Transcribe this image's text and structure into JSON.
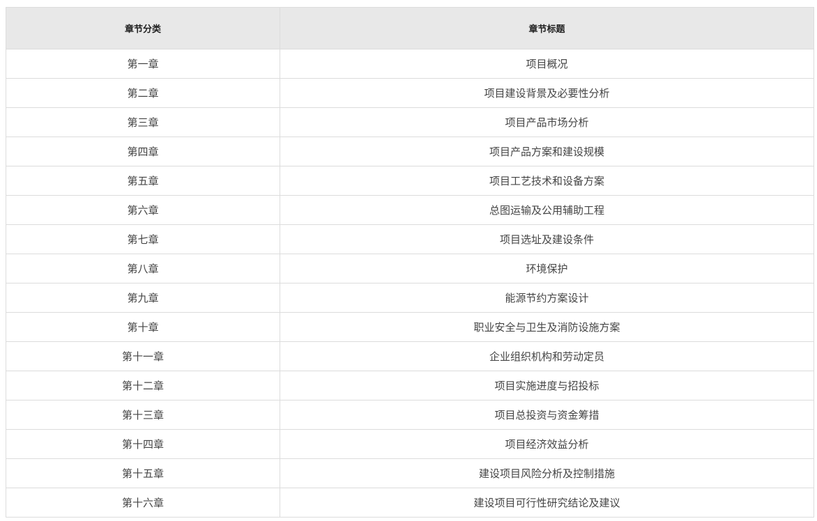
{
  "table": {
    "headers": {
      "category": "章节分类",
      "title": "章节标题"
    },
    "rows": [
      {
        "category": "第一章",
        "title": "项目概况"
      },
      {
        "category": "第二章",
        "title": "项目建设背景及必要性分析"
      },
      {
        "category": "第三章",
        "title": "项目产品市场分析"
      },
      {
        "category": "第四章",
        "title": "项目产品方案和建设规模"
      },
      {
        "category": "第五章",
        "title": "项目工艺技术和设备方案"
      },
      {
        "category": "第六章",
        "title": "总图运输及公用辅助工程"
      },
      {
        "category": "第七章",
        "title": "项目选址及建设条件"
      },
      {
        "category": "第八章",
        "title": "环境保护"
      },
      {
        "category": "第九章",
        "title": "能源节约方案设计"
      },
      {
        "category": "第十章",
        "title": "职业安全与卫生及消防设施方案"
      },
      {
        "category": "第十一章",
        "title": "企业组织机构和劳动定员"
      },
      {
        "category": "第十二章",
        "title": "项目实施进度与招投标"
      },
      {
        "category": "第十三章",
        "title": "项目总投资与资金筹措"
      },
      {
        "category": "第十四章",
        "title": "项目经济效益分析"
      },
      {
        "category": "第十五章",
        "title": "建设项目风险分析及控制措施"
      },
      {
        "category": "第十六章",
        "title": "建设项目可行性研究结论及建议"
      }
    ]
  }
}
